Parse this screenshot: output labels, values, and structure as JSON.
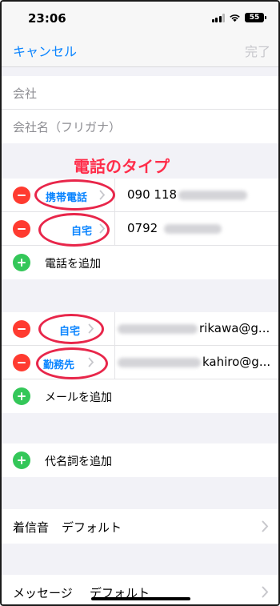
{
  "status_bar": {
    "time": "23:06",
    "battery": "55"
  },
  "nav": {
    "cancel": "キャンセル",
    "done": "完了"
  },
  "company": {
    "company_placeholder": "会社",
    "company_kana_placeholder": "会社名（フリガナ）"
  },
  "annotation": {
    "title": "電話のタイプ"
  },
  "phones": [
    {
      "type": "携帯電話",
      "value_visible": "090 118"
    },
    {
      "type": "自宅",
      "value_visible": "0792"
    }
  ],
  "add_phone": "電話を追加",
  "emails": [
    {
      "type": "自宅",
      "value_visible": "rikawa@g..."
    },
    {
      "type": "勤務先",
      "value_visible": "kahiro@g..."
    }
  ],
  "add_email": "メールを追加",
  "add_pronoun": "代名詞を追加",
  "ringtone": {
    "label": "着信音",
    "value": "デフォルト"
  },
  "message_tone": {
    "label": "メッセージ",
    "value": "デフォルト"
  },
  "colors": {
    "accent": "#0a84ff",
    "delete": "#ff3b30",
    "add": "#34c759",
    "annotation": "#e8264a"
  }
}
